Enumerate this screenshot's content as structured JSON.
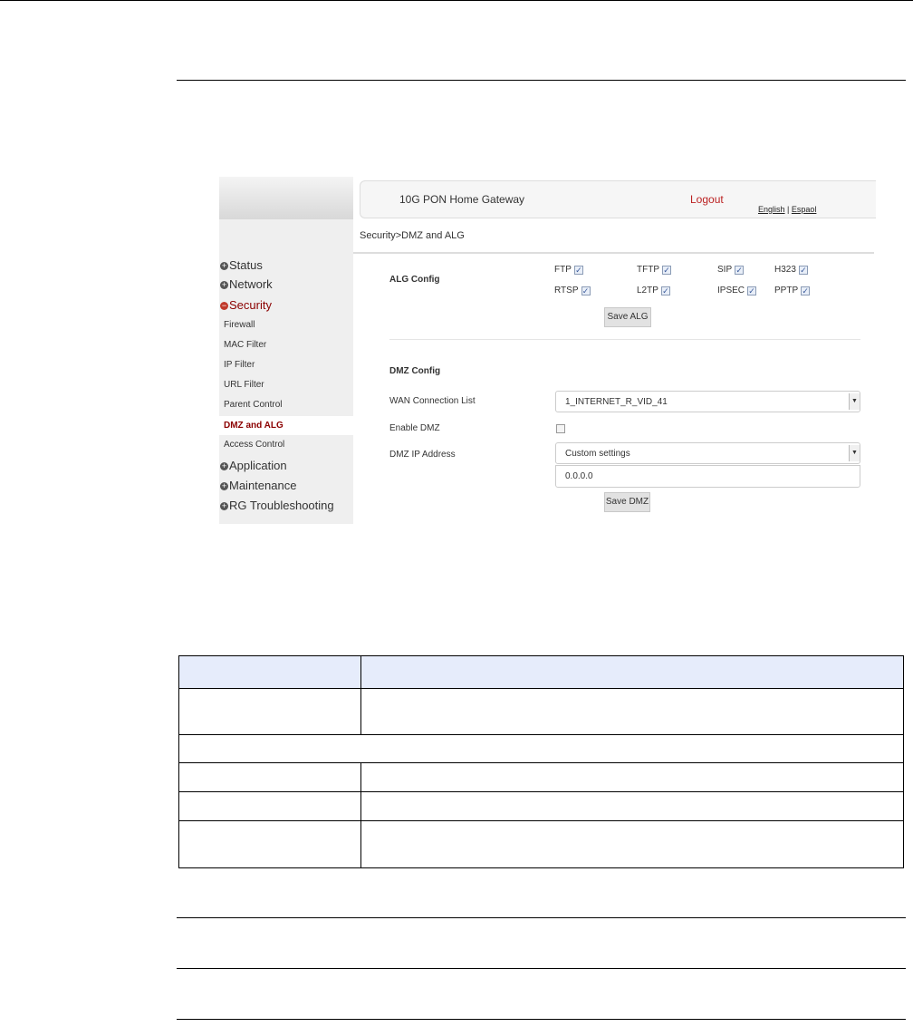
{
  "gui": {
    "header_title": "10G PON Home Gateway",
    "logout": "Logout",
    "lang_english": "English",
    "lang_sep": " | ",
    "lang_espanol": "Espaol",
    "breadcrumb": "Security>DMZ and ALG",
    "sidebar": [
      {
        "label": "Status",
        "type": "group",
        "icon": "plus-icon"
      },
      {
        "label": "Network",
        "type": "group",
        "icon": "plus-icon"
      },
      {
        "label": "Security",
        "type": "group",
        "icon": "minus-icon",
        "expanded": true
      },
      {
        "label": "Firewall",
        "type": "sub"
      },
      {
        "label": "MAC Filter",
        "type": "sub"
      },
      {
        "label": "IP Filter",
        "type": "sub"
      },
      {
        "label": "URL Filter",
        "type": "sub"
      },
      {
        "label": "Parent Control",
        "type": "sub"
      },
      {
        "label": "DMZ and ALG",
        "type": "sub",
        "active": true
      },
      {
        "label": "Access Control",
        "type": "sub"
      },
      {
        "label": "Application",
        "type": "group",
        "icon": "plus-icon"
      },
      {
        "label": "Maintenance",
        "type": "group",
        "icon": "plus-icon"
      },
      {
        "label": "RG Troubleshooting",
        "type": "group",
        "icon": "plus-icon"
      }
    ],
    "alg": {
      "title": "ALG Config",
      "items": [
        {
          "label": "FTP",
          "checked": true
        },
        {
          "label": "TFTP",
          "checked": true
        },
        {
          "label": "SIP",
          "checked": true
        },
        {
          "label": "H323",
          "checked": true
        },
        {
          "label": "RTSP",
          "checked": true
        },
        {
          "label": "L2TP",
          "checked": true
        },
        {
          "label": "IPSEC",
          "checked": true
        },
        {
          "label": "PPTP",
          "checked": true
        }
      ],
      "save": "Save ALG"
    },
    "dmz": {
      "title": "DMZ Config",
      "wan_label": "WAN Connection List",
      "wan_value": "1_INTERNET_R_VID_41",
      "enable_label": "Enable DMZ",
      "enable_checked": false,
      "ip_label": "DMZ IP Address",
      "ip_mode": "Custom settings",
      "ip_value": "0.0.0.0",
      "save": "Save DMZ"
    },
    "colors": {
      "accent_red": "#8b0000",
      "table_header": "#e6ecfb"
    }
  },
  "table": {
    "header": [
      "",
      ""
    ],
    "rows": [
      [
        "",
        ""
      ],
      [
        ""
      ],
      [
        "",
        ""
      ],
      [
        "",
        ""
      ],
      [
        "",
        ""
      ]
    ]
  }
}
